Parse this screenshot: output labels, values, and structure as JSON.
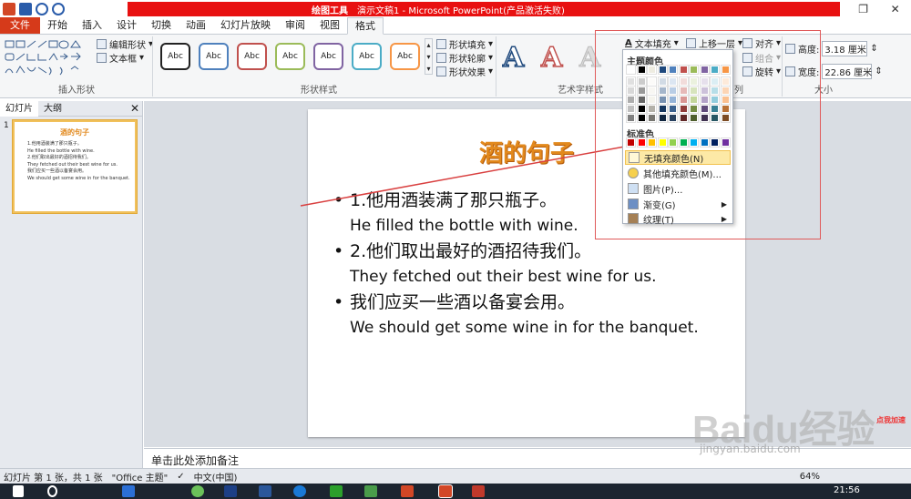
{
  "window": {
    "context_tab": "绘图工具",
    "title": "演示文稿1 - Microsoft PowerPoint(产品激活失败)"
  },
  "tabs": [
    "文件",
    "开始",
    "插入",
    "设计",
    "切换",
    "动画",
    "幻灯片放映",
    "审阅",
    "视图",
    "格式"
  ],
  "ribbon": {
    "insert_shapes_label": "插入形状",
    "edit_shape": "编辑形状",
    "textbox": "文本框",
    "shape_styles_label": "形状样式",
    "style_text": "Abc",
    "shape_fill": "形状填充",
    "shape_outline": "形状轮廓",
    "shape_effects": "形状效果",
    "wordart_label": "艺术字样式",
    "text_fill": "文本填充",
    "bring_forward": "上移一层",
    "align": "对齐",
    "group": "组合",
    "rotate": "旋转",
    "size_label": "大小",
    "height_label": "高度:",
    "height_value": "3.18 厘米",
    "width_label": "宽度:",
    "width_value": "22.86 厘米",
    "arrange_label": "列"
  },
  "left_panel": {
    "tab_slides": "幻灯片",
    "tab_outline": "大纲",
    "slide_number": "1",
    "thumb_title": "酒的句子",
    "thumb_lines": [
      "1.他用酒装满了那只瓶子。",
      "He filled the bottle with wine.",
      "2.他们取出最好的酒招待我们。",
      "They fetched out their best wine for us.",
      "我们应买一些酒以备宴会用。",
      "We should get some wine in for the banquet."
    ]
  },
  "slide": {
    "title": "酒的句子",
    "bullets": [
      {
        "zh": "1.他用酒装满了那只瓶子。",
        "en": "He filled the bottle with wine."
      },
      {
        "zh": "2.他们取出最好的酒招待我们。",
        "en": "They fetched out their best wine for us."
      },
      {
        "zh": "我们应买一些酒以备宴会用。",
        "en": "We should get some wine in for the banquet."
      }
    ]
  },
  "dropdown": {
    "theme_colors": "主题颜色",
    "standard_colors": "标准色",
    "no_fill": "无填充颜色(N)",
    "more_colors": "其他填充颜色(M)...",
    "picture": "图片(P)...",
    "gradient": "渐变(G)",
    "texture": "纹理(T)",
    "theme_top_row": [
      "#ffffff",
      "#000000",
      "#eeece1",
      "#1f497d",
      "#4f81bd",
      "#c0504d",
      "#9bbb59",
      "#8064a2",
      "#4bacc6",
      "#f79646"
    ],
    "standard_row": [
      "#c00000",
      "#ff0000",
      "#ffc000",
      "#ffff00",
      "#92d050",
      "#00b050",
      "#00b0f0",
      "#0070c0",
      "#002060",
      "#7030a0"
    ]
  },
  "notes": "单击此处添加备注",
  "status": {
    "slide_info": "幻灯片 第 1 张，共 1 张",
    "theme": "\"Office 主题\"",
    "lang": "中文(中国)",
    "zoom": "64%"
  },
  "taskbar": {
    "time": "21:56"
  },
  "watermark": {
    "brand": "Baidu经验",
    "url": "jingyan.baidu.com",
    "badge": "点我加速"
  }
}
